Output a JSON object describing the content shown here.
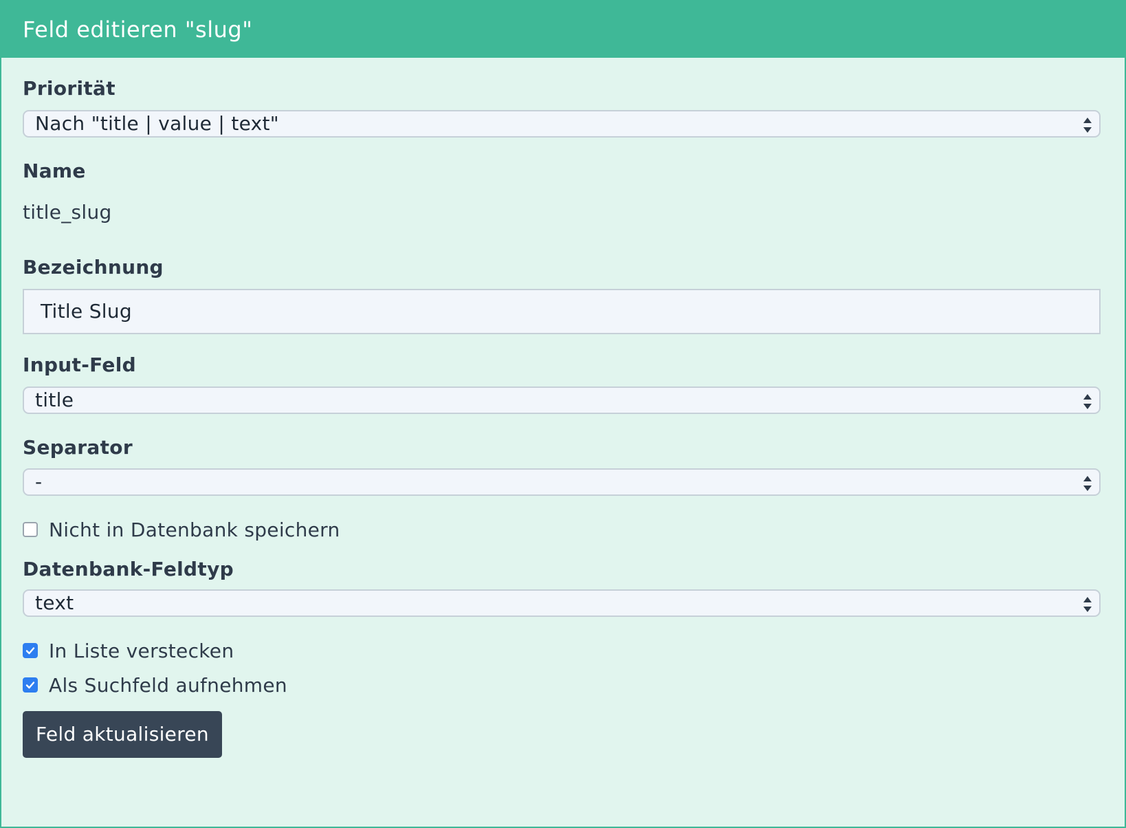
{
  "header": {
    "title": "Feld editieren \"slug\""
  },
  "form": {
    "priority": {
      "label": "Priorität",
      "selected": "Nach \"title | value | text\""
    },
    "name": {
      "label": "Name",
      "value": "title_slug"
    },
    "bezeichnung": {
      "label": "Bezeichnung",
      "value": "Title Slug"
    },
    "input_feld": {
      "label": "Input-Feld",
      "selected": "title"
    },
    "separator": {
      "label": "Separator",
      "selected": "-"
    },
    "no_db": {
      "label": "Nicht in Datenbank speichern",
      "checked": false
    },
    "db_type": {
      "label": "Datenbank-Feldtyp",
      "selected": "text"
    },
    "hide_in_list": {
      "label": "In Liste verstecken",
      "checked": true
    },
    "search_field": {
      "label": "Als Suchfeld aufnehmen",
      "checked": true
    },
    "submit_label": "Feld aktualisieren"
  },
  "colors": {
    "header_bg": "#3fb897",
    "panel_bg": "#e1f5ee",
    "button_bg": "#384656",
    "checkbox_checked": "#2d7ef0"
  }
}
